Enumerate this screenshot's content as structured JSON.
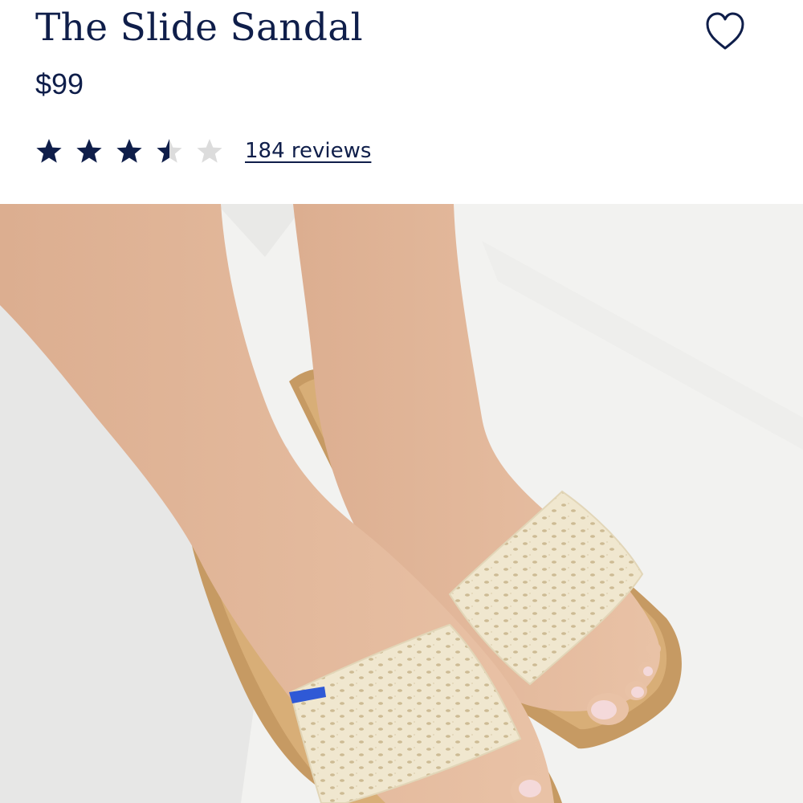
{
  "product": {
    "name": "The Slide Sandal",
    "price": "$99",
    "rating": 3.5,
    "rating_max": 5,
    "reviews_label": "184 reviews"
  },
  "icons": {
    "favorite": "heart-outline-icon",
    "star": "star-icon"
  },
  "colors": {
    "text": "#0f1e4a",
    "star_filled": "#0f1e4a",
    "star_empty": "#dcdcdc",
    "image_background": "#f2f2f0",
    "sandal_sole": "#c69a63",
    "sandal_strap": "#f0e7cf",
    "strap_tab": "#2f59d6"
  }
}
